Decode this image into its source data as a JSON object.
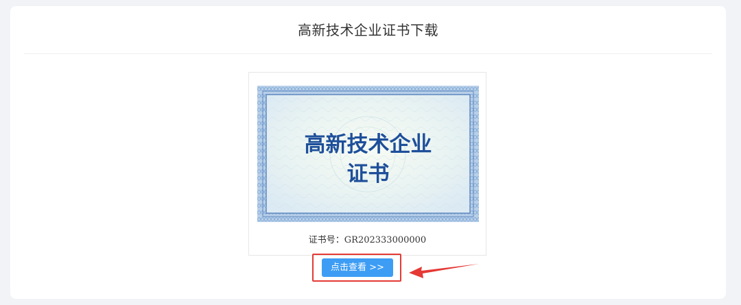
{
  "page": {
    "title": "高新技术企业证书下载"
  },
  "certificate": {
    "image_text_line1": "高新技术企业",
    "image_text_line2": "证书",
    "number_text": "证书号：GR202333000000"
  },
  "action": {
    "view_label": "点击查看 >>"
  },
  "colors": {
    "accent": "#3d9df4",
    "annotation": "#e53935",
    "cert_text": "#1e4f9a",
    "cert_border": "#6f9bd0"
  },
  "icons": {
    "pointer": "red-arrow-icon"
  }
}
